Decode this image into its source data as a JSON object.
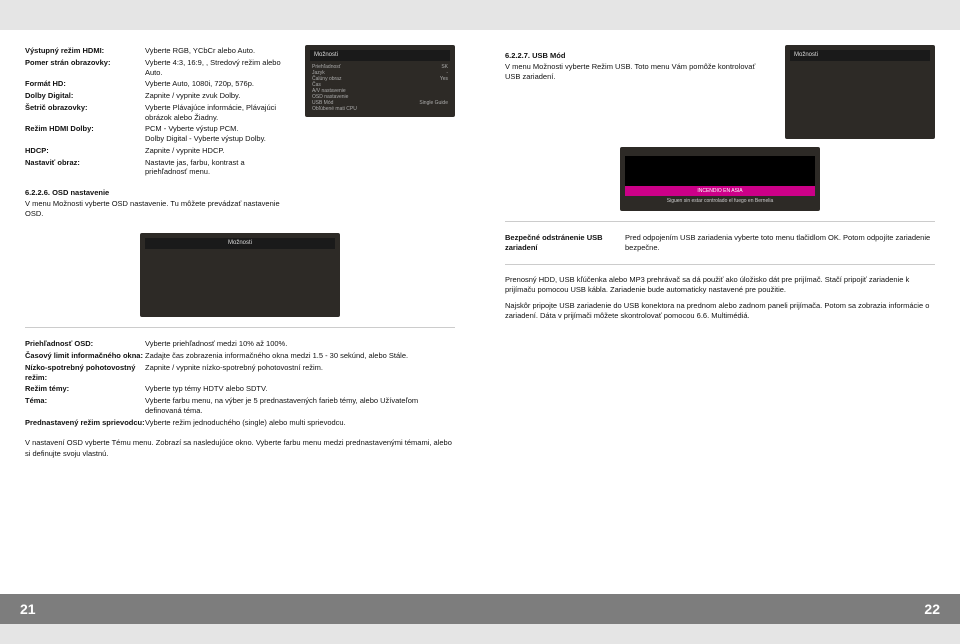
{
  "pageLeft": "21",
  "pageRight": "22",
  "leftTable1": [
    {
      "k": "Výstupný režim HDMI:",
      "v": "Vyberte RGB, YCbCr alebo Auto."
    },
    {
      "k": "Pomer strán obrazovky:",
      "v": "Vyberte 4:3, 16:9, , Stredový režim alebo Auto."
    },
    {
      "k": "Formát HD:",
      "v": "Vyberte Auto, 1080i, 720p, 576p."
    },
    {
      "k": "Dolby Digital:",
      "v": "Zapnite / vypnite zvuk Dolby."
    },
    {
      "k": "Šetrič obrazovky:",
      "v": "Vyberte Plávajúce informácie, Plávajúci obrázok alebo Žiadny."
    },
    {
      "k": "Režim HDMI Dolby:",
      "v": "PCM - Vyberte výstup PCM.\nDolby Digital - Vyberte výstup Dolby."
    },
    {
      "k": "HDCP:",
      "v": "Zapnite / vypnite HDCP."
    },
    {
      "k": "Nastaviť obraz:",
      "v": "Nastavte jas, farbu, kontrast a priehľadnosť menu."
    }
  ],
  "leftHeading1": "6.2.2.6. OSD nastavenie",
  "leftBody1": "V menu Možnosti vyberte OSD nastavenie. Tu môžete prevádzať nastavenie OSD.",
  "leftTable2": [
    {
      "k": "Priehľadnosť OSD:",
      "v": "Vyberte priehľadnosť medzi 10% až 100%."
    },
    {
      "k": "Časový limit informačného okna:",
      "v": "Zadajte čas zobrazenia informačného okna medzi 1.5 - 30 sekúnd, alebo Stále."
    },
    {
      "k": "Nízko-spotrebný pohotovostný režim:",
      "v": "Zapnite / vypnite nízko-spotrebný pohotovostní režim."
    },
    {
      "k": "Režim témy:",
      "v": "Vyberte typ témy HDTV alebo SDTV."
    },
    {
      "k": "Téma:",
      "v": "Vyberte farbu menu, na výber je 5 prednastavených farieb témy, alebo Užívateľom definovaná téma."
    },
    {
      "k": "Prednastavený režim sprievodcu:",
      "v": "Vyberte režim jednoduchého (single) alebo multi sprievodcu."
    }
  ],
  "leftBody2": "V nastavení OSD vyberte Tému menu. Zobrazí sa nasledujúce okno. Vyberte farbu menu medzi prednastavenými témami, alebo si definujte svoju vlastnú.",
  "rightHeading1": "6.2.2.7. USB Mód",
  "rightBody1": "V menu Možnosti vyberte Režim USB. Toto menu Vám pomôže kontrolovať USB zariadení.",
  "rightTable1": [
    {
      "k": "Bezpečné odstránenie USB zariadení",
      "v": "Pred odpojením USB zariadenia vyberte toto menu tlačidlom OK. Potom odpojíte zariadenie bezpečne."
    }
  ],
  "rightBody2": "Prenosný HDD, USB kľúčenka alebo MP3 prehrávač sa dá použiť ako úložisko dát pre prijímač. Stačí pripojiť zariadenie k prijímaču pomocou USB kábla. Zariadenie bude automaticky nastavené pre použitie.",
  "rightBody3": "Najskôr pripojte USB zariadenie do USB konektora na prednom alebo zadnom paneli prijímača. Potom sa zobrazia informácie o zariadení. Dáta v prijímači môžete skontrolovať pomocou 6.6. Multimédiá.",
  "ui1": {
    "title": "Možnosti",
    "items": [
      "Priehľadnosť",
      "Jazyk",
      "Čalúny obraz",
      "Čas",
      "A/V nastavenie",
      "OSD nastavenie",
      "USB Mód",
      "Obľúbené mati CPU"
    ],
    "vals": [
      "SK",
      "-",
      "Yes",
      "",
      "",
      "",
      "Single Guide"
    ]
  },
  "ui2": {
    "title": "Možnosti"
  },
  "ui3": {
    "title": "Možnosti"
  },
  "ui4title": "INCENDIO EN ASIA",
  "ui4line": "Siguen sin estar controlado el fuego en Bernelia"
}
